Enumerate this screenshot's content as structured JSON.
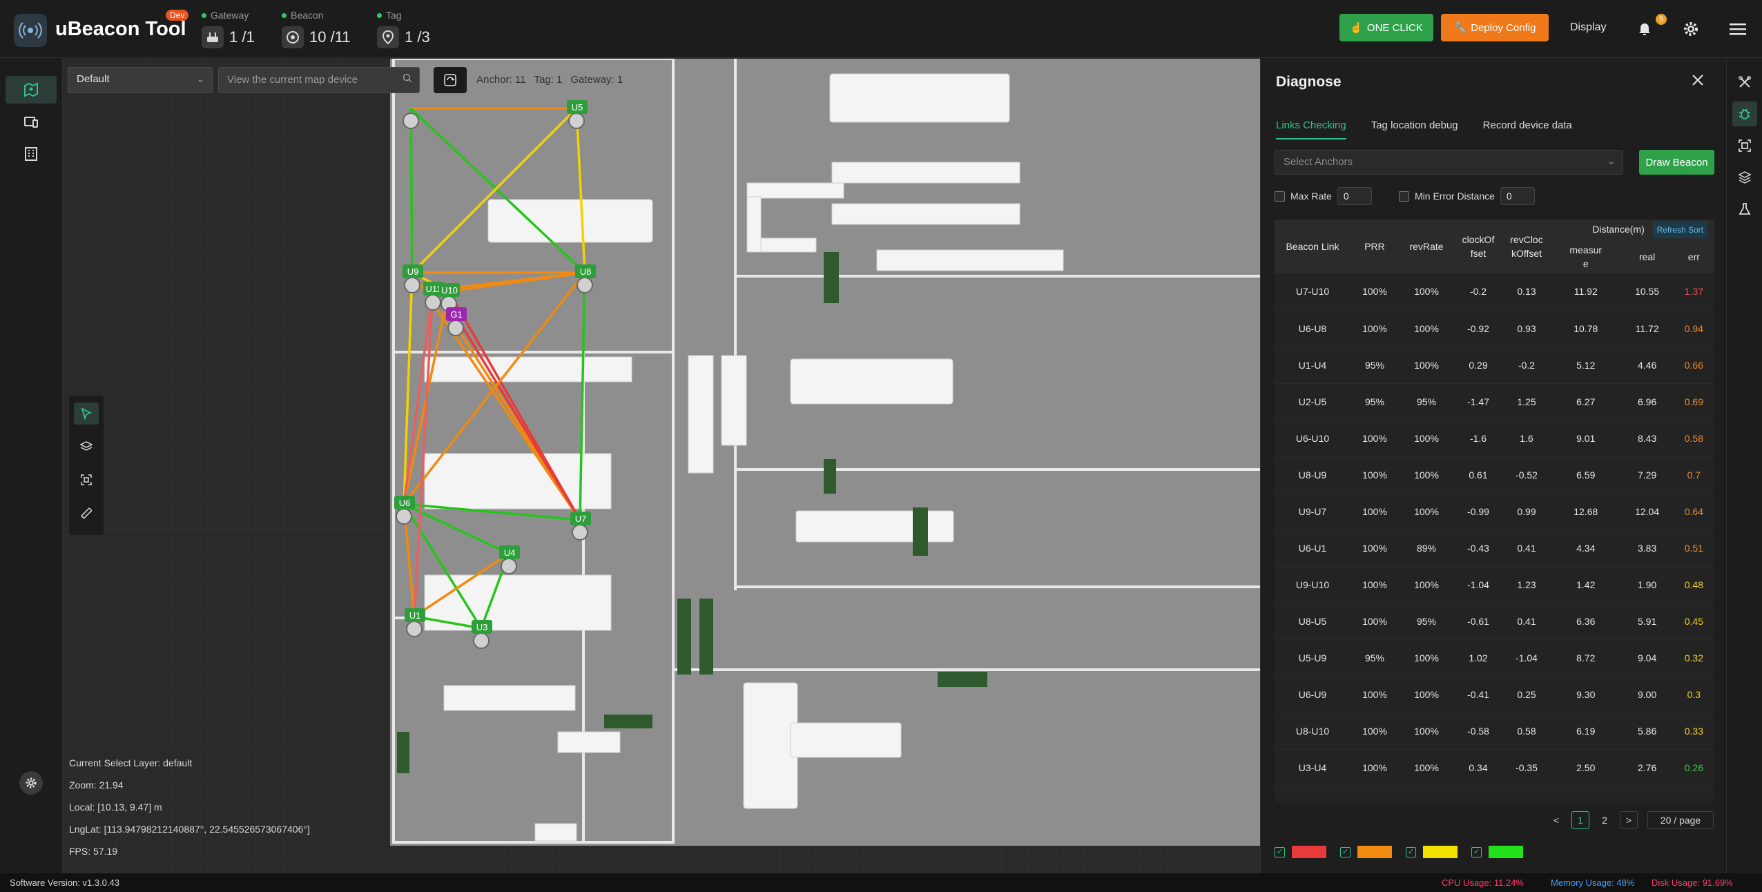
{
  "app": {
    "title": "uBeacon Tool",
    "badge": "Dev"
  },
  "stats": {
    "gateway": {
      "label": "Gateway",
      "value": "1 /1"
    },
    "beacon": {
      "label": "Beacon",
      "value": "10 /11"
    },
    "tag": {
      "label": "Tag",
      "value": "1 /3"
    }
  },
  "top_actions": {
    "one_click": "ONE CLICK",
    "deploy": "Deploy Config",
    "display": "Display",
    "notifications": "5"
  },
  "map": {
    "layer_select": "Default",
    "search_placeholder": "View the current map device",
    "counts": {
      "anchor": "Anchor: 11",
      "tag": "Tag: 1",
      "gateway": "Gateway: 1"
    },
    "info": {
      "layer": "Current Select Layer:   default",
      "zoom": "Zoom:   21.94",
      "local": "Local:   [10.13,  9.47] m",
      "lnglat": "LngLat:   [113.94798212140887°,  22.545526573067406°]",
      "fps": "FPS:   57.19"
    },
    "nodes": [
      {
        "id": "U5"
      },
      {
        "id": "U9"
      },
      {
        "id": "U8"
      },
      {
        "id": "U11"
      },
      {
        "id": "U10"
      },
      {
        "id": "G1"
      },
      {
        "id": "U6"
      },
      {
        "id": "U7"
      },
      {
        "id": "U4"
      },
      {
        "id": "U1"
      },
      {
        "id": "U3"
      }
    ]
  },
  "diagnose": {
    "title": "Diagnose",
    "tabs": [
      "Links Checking",
      "Tag location debug",
      "Record device data"
    ],
    "anchor_placeholder": "Select Anchors",
    "draw_button": "Draw Beacon",
    "max_rate": {
      "label": "Max Rate",
      "value": "0"
    },
    "min_error": {
      "label": "Min Error Distance",
      "value": "0"
    },
    "headers": {
      "link": "Beacon Link",
      "prr": "PRR",
      "revrate": "revRate",
      "clock": "clockOf\nfset",
      "revclock": "revCloc\nkOffset",
      "distance": "Distance(m)",
      "refresh_sort": "Refresh Sort",
      "measure": "measur\ne",
      "real": "real",
      "err": "err"
    },
    "rows": [
      {
        "link": "U7-U10",
        "prr": "100%",
        "rev": "100%",
        "clk": "-0.2",
        "rclk": "0.13",
        "meas": "11.92",
        "real": "10.55",
        "err": "1.37",
        "color": "#f05050"
      },
      {
        "link": "U6-U8",
        "prr": "100%",
        "rev": "100%",
        "clk": "-0.92",
        "rclk": "0.93",
        "meas": "10.78",
        "real": "11.72",
        "err": "0.94",
        "color": "#f08a2a"
      },
      {
        "link": "U1-U4",
        "prr": "95%",
        "rev": "100%",
        "clk": "0.29",
        "rclk": "-0.2",
        "meas": "5.12",
        "real": "4.46",
        "err": "0.66",
        "color": "#f08a2a"
      },
      {
        "link": "U2-U5",
        "prr": "95%",
        "rev": "95%",
        "clk": "-1.47",
        "rclk": "1.25",
        "meas": "6.27",
        "real": "6.96",
        "err": "0.69",
        "color": "#f08a2a"
      },
      {
        "link": "U6-U10",
        "prr": "100%",
        "rev": "100%",
        "clk": "-1.6",
        "rclk": "1.6",
        "meas": "9.01",
        "real": "8.43",
        "err": "0.58",
        "color": "#f08a2a"
      },
      {
        "link": "U8-U9",
        "prr": "100%",
        "rev": "100%",
        "clk": "0.61",
        "rclk": "-0.52",
        "meas": "6.59",
        "real": "7.29",
        "err": "0.7",
        "color": "#f08a2a"
      },
      {
        "link": "U9-U7",
        "prr": "100%",
        "rev": "100%",
        "clk": "-0.99",
        "rclk": "0.99",
        "meas": "12.68",
        "real": "12.04",
        "err": "0.64",
        "color": "#f08a2a"
      },
      {
        "link": "U6-U1",
        "prr": "100%",
        "rev": "89%",
        "clk": "-0.43",
        "rclk": "0.41",
        "meas": "4.34",
        "real": "3.83",
        "err": "0.51",
        "color": "#f08a2a"
      },
      {
        "link": "U9-U10",
        "prr": "100%",
        "rev": "100%",
        "clk": "-1.04",
        "rclk": "1.23",
        "meas": "1.42",
        "real": "1.90",
        "err": "0.48",
        "color": "#f0d020"
      },
      {
        "link": "U8-U5",
        "prr": "100%",
        "rev": "95%",
        "clk": "-0.61",
        "rclk": "0.41",
        "meas": "6.36",
        "real": "5.91",
        "err": "0.45",
        "color": "#f0d020"
      },
      {
        "link": "U5-U9",
        "prr": "95%",
        "rev": "100%",
        "clk": "1.02",
        "rclk": "-1.04",
        "meas": "8.72",
        "real": "9.04",
        "err": "0.32",
        "color": "#f0d020"
      },
      {
        "link": "U6-U9",
        "prr": "100%",
        "rev": "100%",
        "clk": "-0.41",
        "rclk": "0.25",
        "meas": "9.30",
        "real": "9.00",
        "err": "0.3",
        "color": "#f0d020"
      },
      {
        "link": "U8-U10",
        "prr": "100%",
        "rev": "100%",
        "clk": "-0.58",
        "rclk": "0.58",
        "meas": "6.19",
        "real": "5.86",
        "err": "0.33",
        "color": "#f0d020"
      },
      {
        "link": "U3-U4",
        "prr": "100%",
        "rev": "100%",
        "clk": "0.34",
        "rclk": "-0.35",
        "meas": "2.50",
        "real": "2.76",
        "err": "0.26",
        "color": "#36d040"
      }
    ],
    "pagination": {
      "prev": "<",
      "page1": "1",
      "page2": "2",
      "next": ">",
      "page_size": "20 / page"
    },
    "legend_colors": [
      "#e83a3a",
      "#f08a10",
      "#f2e000",
      "#22e01a"
    ]
  },
  "status": {
    "version": "Software Version:  v1.3.0.43",
    "cpu": "CPU Usage:  11.24%",
    "memory": "Memory Usage:  48%",
    "disk": "Disk Usage:  91.69%"
  }
}
